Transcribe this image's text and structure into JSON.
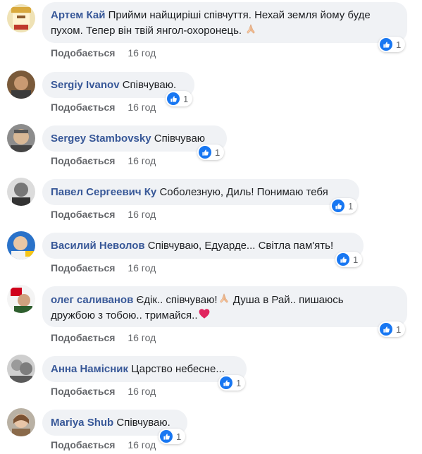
{
  "like_label": "Подобається",
  "comments": [
    {
      "author": "Артем Кай",
      "text_line1": "Прийми найщиріші співчуття. Нехай земля йому буде",
      "text_line2": "пухом. Тепер він твій янгол-охоронець.",
      "emoji": "folded-hands",
      "reactions": "1",
      "time": "16 год"
    },
    {
      "author": "Sergiy Ivanov",
      "text_line1": "Співчуваю.",
      "reactions": "1",
      "time": "16 год"
    },
    {
      "author": "Sergey Stambovsky",
      "text_line1": "Співчуваю",
      "reactions": "1",
      "time": "16 год"
    },
    {
      "author": "Павел Сергеевич Ку",
      "text_line1": "Соболезную, Диль! Понимаю тебя",
      "reactions": "1",
      "time": "16 год"
    },
    {
      "author": "Василий Неволов",
      "text_line1": "Співчуваю, Едуарде... Світла пам'ять!",
      "reactions": "1",
      "time": "16 год"
    },
    {
      "author": "олег саливанов",
      "text_line1": "Єдік.. співчуваю!",
      "text_line1b": "Душа в Рай.. пишаюсь",
      "text_line2": "дружбою з тобою.. тримайся..",
      "emoji": "folded-hands",
      "emoji2": "red-heart",
      "reactions": "1",
      "time": "16 год"
    },
    {
      "author": "Анна Намісник",
      "text_line1": "Царство небесне...",
      "reactions": "1",
      "time": "16 год"
    },
    {
      "author": "Mariya Shub",
      "text_line1": "Співчуваю.",
      "reactions": "1",
      "time": "16 год"
    }
  ]
}
